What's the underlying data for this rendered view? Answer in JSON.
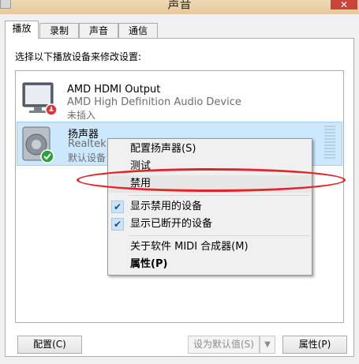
{
  "window": {
    "title": "声音"
  },
  "tabs": [
    {
      "label": "播放"
    },
    {
      "label": "录制"
    },
    {
      "label": "声音"
    },
    {
      "label": "通信"
    }
  ],
  "instruction": "选择以下播放设备来修改设置:",
  "devices": [
    {
      "name": "AMD HDMI Output",
      "description": "AMD High Definition Audio Device",
      "status": "未插入",
      "icon": "monitor-icon",
      "badge": "unplugged-icon"
    },
    {
      "name": "扬声器",
      "description": "Realtek",
      "status": "默认设备",
      "icon": "speaker-icon",
      "badge": "default-check-icon",
      "selected": true
    }
  ],
  "context_menu": {
    "items": [
      {
        "label": "配置扬声器(S)"
      },
      {
        "label": "测试"
      },
      {
        "label": "禁用"
      },
      {
        "label": "显示禁用的设备",
        "checked": true
      },
      {
        "label": "显示已断开的设备",
        "checked": true
      },
      {
        "label": "关于软件 MIDI 合成器(M)"
      },
      {
        "label": "属性(P)",
        "bold": true
      }
    ]
  },
  "buttons": {
    "configure": "配置(C)",
    "set_default": "设为默认值(S)",
    "properties": "属性(P)"
  },
  "colors": {
    "selection": "#cce8ff",
    "annotation_ring": "#e0262b",
    "default_badge": "#2e9e3f"
  }
}
